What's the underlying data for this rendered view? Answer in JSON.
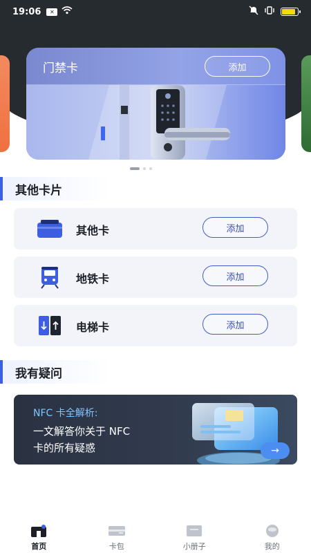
{
  "status_bar": {
    "time": "19:06",
    "notif_badge": "✕",
    "battery_level": 0.85,
    "battery_color": "#f5d90a",
    "icons": [
      "notification-icon",
      "wifi-icon",
      "mute-icon",
      "vibrate-icon",
      "battery-icon"
    ]
  },
  "carousel": {
    "main_card": {
      "title": "门禁卡",
      "add_label": "添加"
    },
    "page_count": 3,
    "active_index": 0
  },
  "other_cards": {
    "section_title": "其他卡片",
    "items": [
      {
        "label": "其他卡",
        "add_label": "添加",
        "icon": "card-icon"
      },
      {
        "label": "地铁卡",
        "add_label": "添加",
        "icon": "metro-train-icon"
      },
      {
        "label": "电梯卡",
        "add_label": "添加",
        "icon": "elevator-icon"
      }
    ]
  },
  "faq": {
    "section_title": "我有疑问",
    "banner": {
      "heading": "NFC 卡全解析:",
      "line1": "一文解答你关于 NFC",
      "line2": "卡的所有疑惑",
      "arrow": "→"
    }
  },
  "tab_bar": {
    "active": "home",
    "tabs": [
      {
        "id": "home",
        "label": "首页",
        "icon": "home-icon"
      },
      {
        "id": "wallet",
        "label": "卡包",
        "icon": "wallet-icon"
      },
      {
        "id": "booklet",
        "label": "小册子",
        "icon": "booklet-icon"
      },
      {
        "id": "mine",
        "label": "我的",
        "icon": "profile-icon"
      }
    ]
  },
  "colors": {
    "accent": "#3d5ee0",
    "header_bg": "#262b30",
    "row_bg": "#f2f4f9"
  }
}
